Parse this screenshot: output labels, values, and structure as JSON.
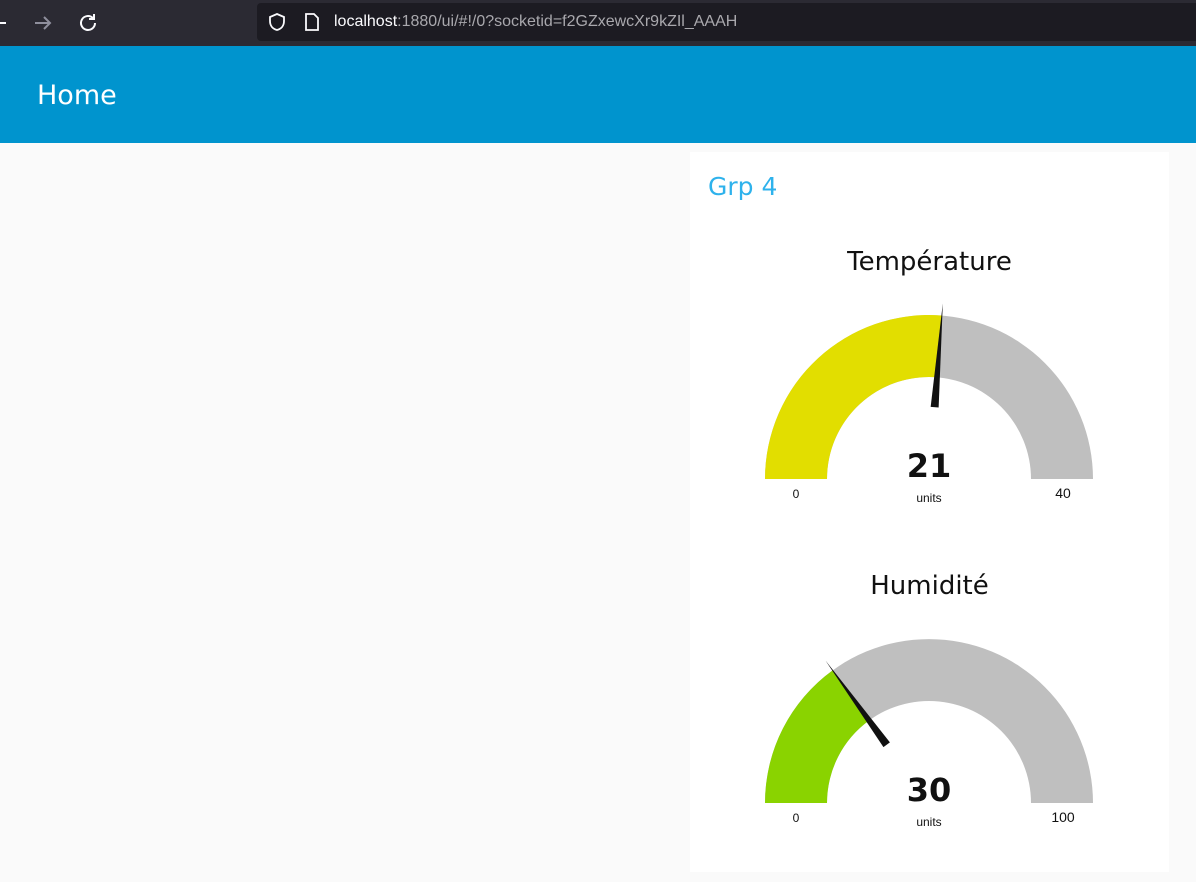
{
  "browser": {
    "url_host": "localhost",
    "url_rest": ":1880/ui/#!/0?socketid=f2GZxewcXr9kZIl_AAAH"
  },
  "header": {
    "title": "Home"
  },
  "group": {
    "title": "Grp 4"
  },
  "gauges": [
    {
      "title": "Température",
      "value": 21,
      "value_label": "21",
      "units": "units",
      "min": 0,
      "max": 40,
      "min_label": "0",
      "max_label": "40",
      "fill_color": "#e2de00",
      "track_color": "#bfbfbf",
      "needle_color": "#111111"
    },
    {
      "title": "Humidité",
      "value": 30,
      "value_label": "30",
      "units": "units",
      "min": 0,
      "max": 100,
      "min_label": "0",
      "max_label": "100",
      "fill_color": "#8ad300",
      "track_color": "#bfbfbf",
      "needle_color": "#111111"
    }
  ]
}
